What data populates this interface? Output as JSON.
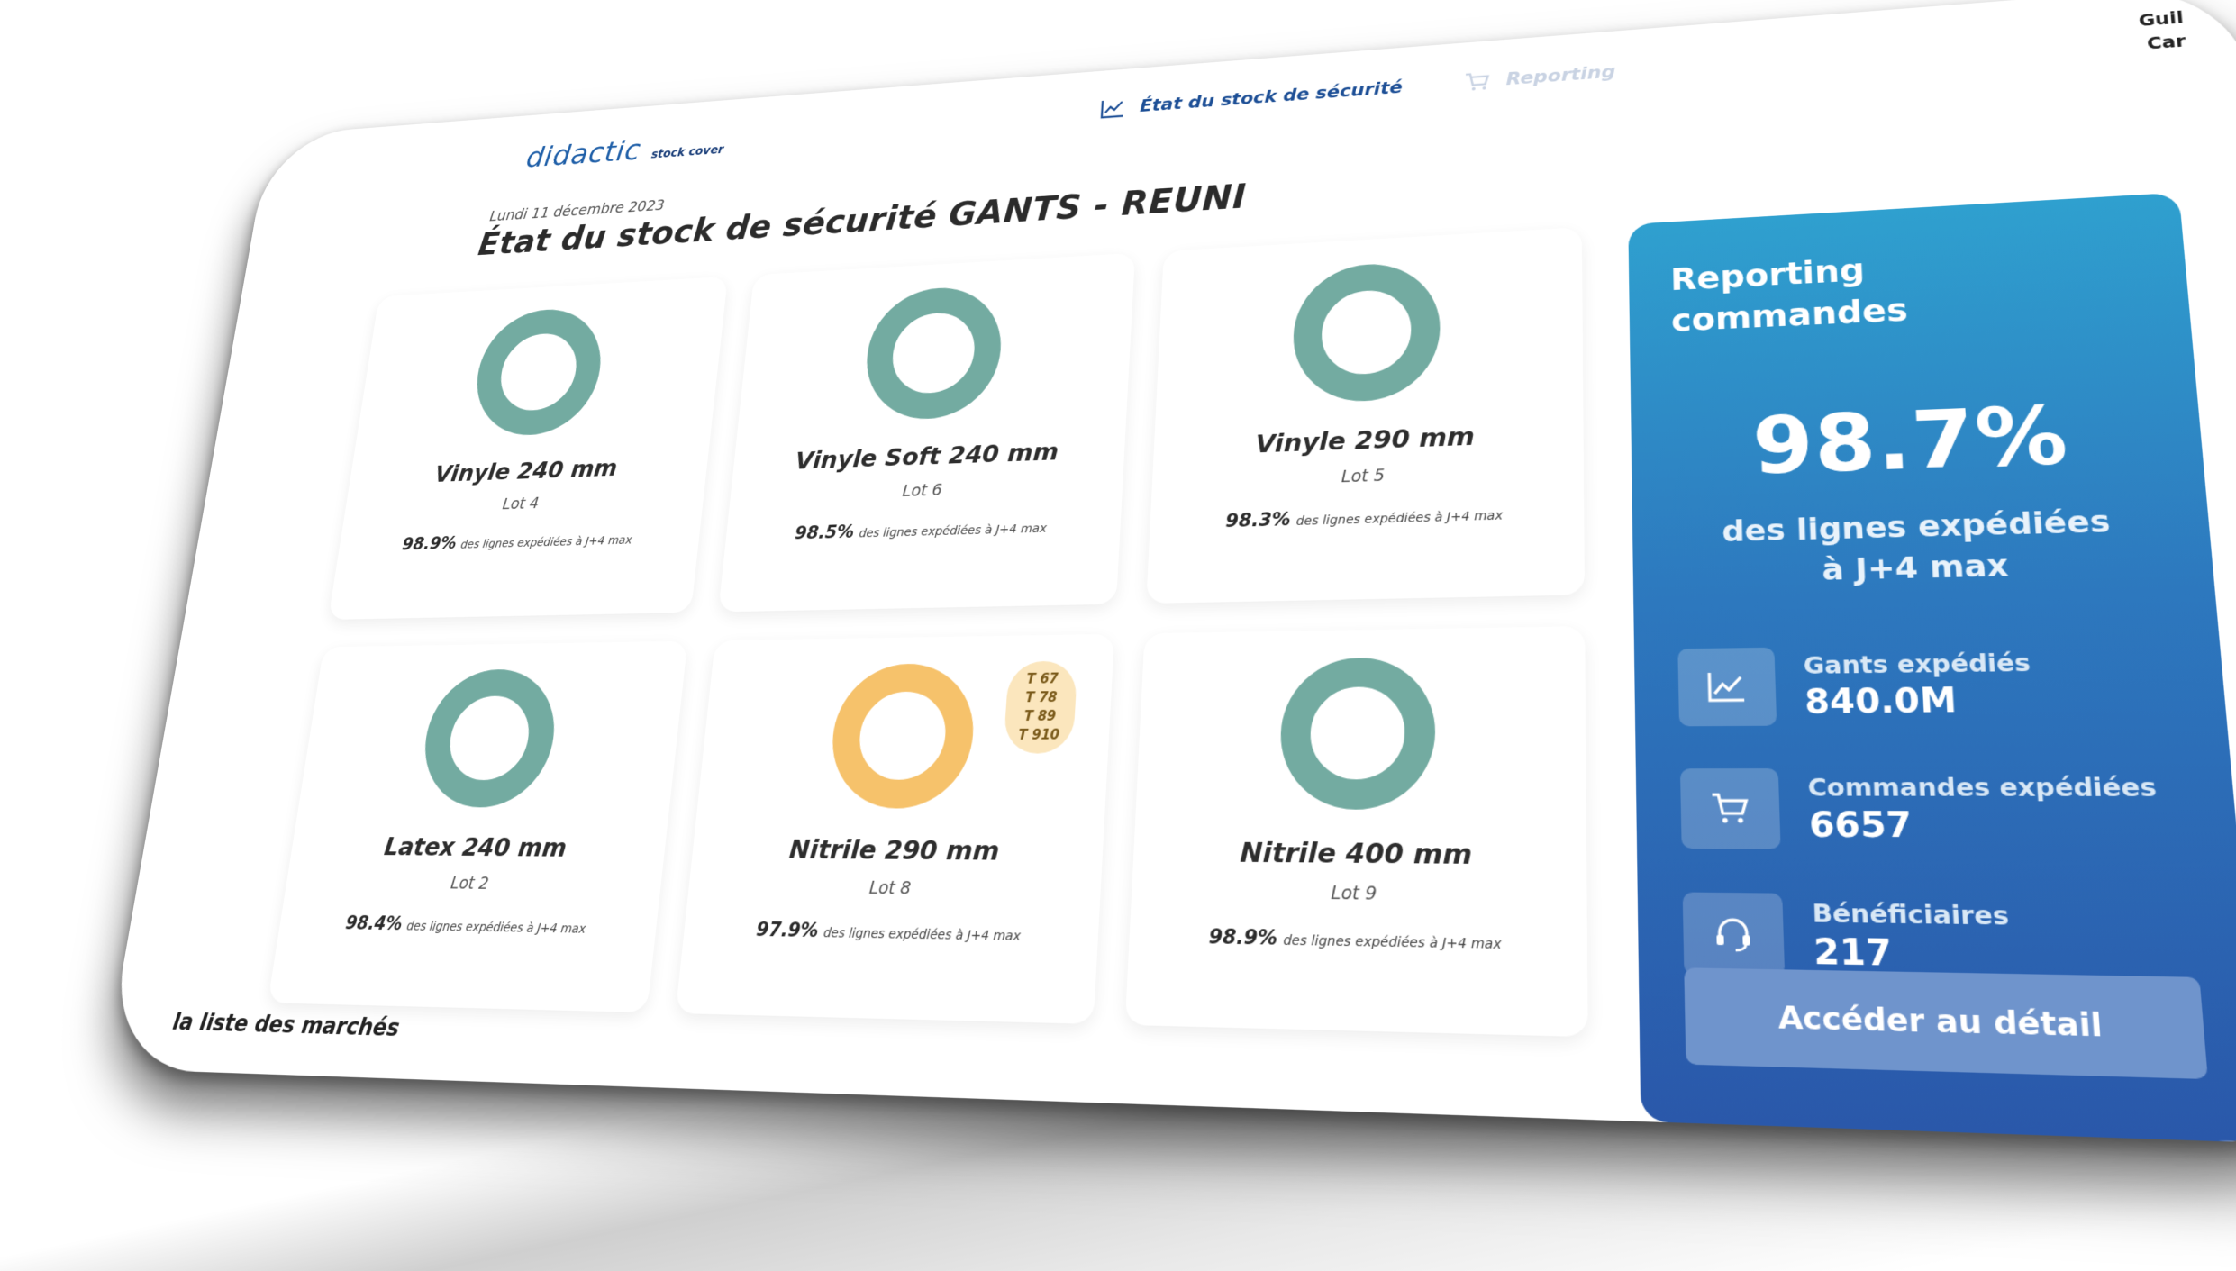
{
  "brand": {
    "name": "didactic",
    "sub": "stock cover"
  },
  "nav": [
    {
      "label": "État du stock de sécurité",
      "icon": "line-chart-icon",
      "active": true
    },
    {
      "label": "Reporting",
      "icon": "cart-icon",
      "active": false
    }
  ],
  "user": {
    "line1": "Guil",
    "line2": "Car"
  },
  "page": {
    "date": "Lundi 11 décembre 2023",
    "title": "État du stock de sécurité GANTS - REUNI"
  },
  "products": [
    {
      "name": "Vinyle 240 mm",
      "lot": "Lot 4",
      "rate": "98.9%",
      "rate_suffix": "des lignes expédiées à J+4 max",
      "status_color": "#73aba1"
    },
    {
      "name": "Vinyle Soft 240 mm",
      "lot": "Lot 6",
      "rate": "98.5%",
      "rate_suffix": "des lignes expédiées à J+4 max",
      "status_color": "#73aba1"
    },
    {
      "name": "Vinyle 290 mm",
      "lot": "Lot 5",
      "rate": "98.3%",
      "rate_suffix": "des lignes expédiées à J+4 max",
      "status_color": "#73aba1"
    },
    {
      "name": "Latex 240 mm",
      "lot": "Lot 2",
      "rate": "98.4%",
      "rate_suffix": "des lignes expédiées à J+4 max",
      "status_color": "#73aba1"
    },
    {
      "name": "Nitrile 290 mm",
      "lot": "Lot 8",
      "rate": "97.9%",
      "rate_suffix": "des lignes expédiées à J+4 max",
      "status_color": "#f6c26b",
      "sizes": [
        "T 67",
        "T 78",
        "T 89",
        "T 910"
      ]
    },
    {
      "name": "Nitrile 400 mm",
      "lot": "Lot 9",
      "rate": "98.9%",
      "rate_suffix": "des lignes expédiées à J+4 max",
      "status_color": "#73aba1"
    }
  ],
  "reporting": {
    "title_line1": "Reporting",
    "title_line2": "commandes",
    "rate": "98.7%",
    "caption_line1": "des lignes expédiées",
    "caption_line2": "à J+4 max",
    "stats": [
      {
        "label": "Gants expédiés",
        "value": "840.0M",
        "icon": "line-chart-icon"
      },
      {
        "label": "Commandes expédiées",
        "value": "6657",
        "icon": "cart-icon"
      },
      {
        "label": "Bénéficiaires",
        "value": "217",
        "icon": "headset-icon"
      }
    ],
    "button_label": "Accéder au détail"
  },
  "footer": {
    "market_link": "la liste des marchés"
  }
}
